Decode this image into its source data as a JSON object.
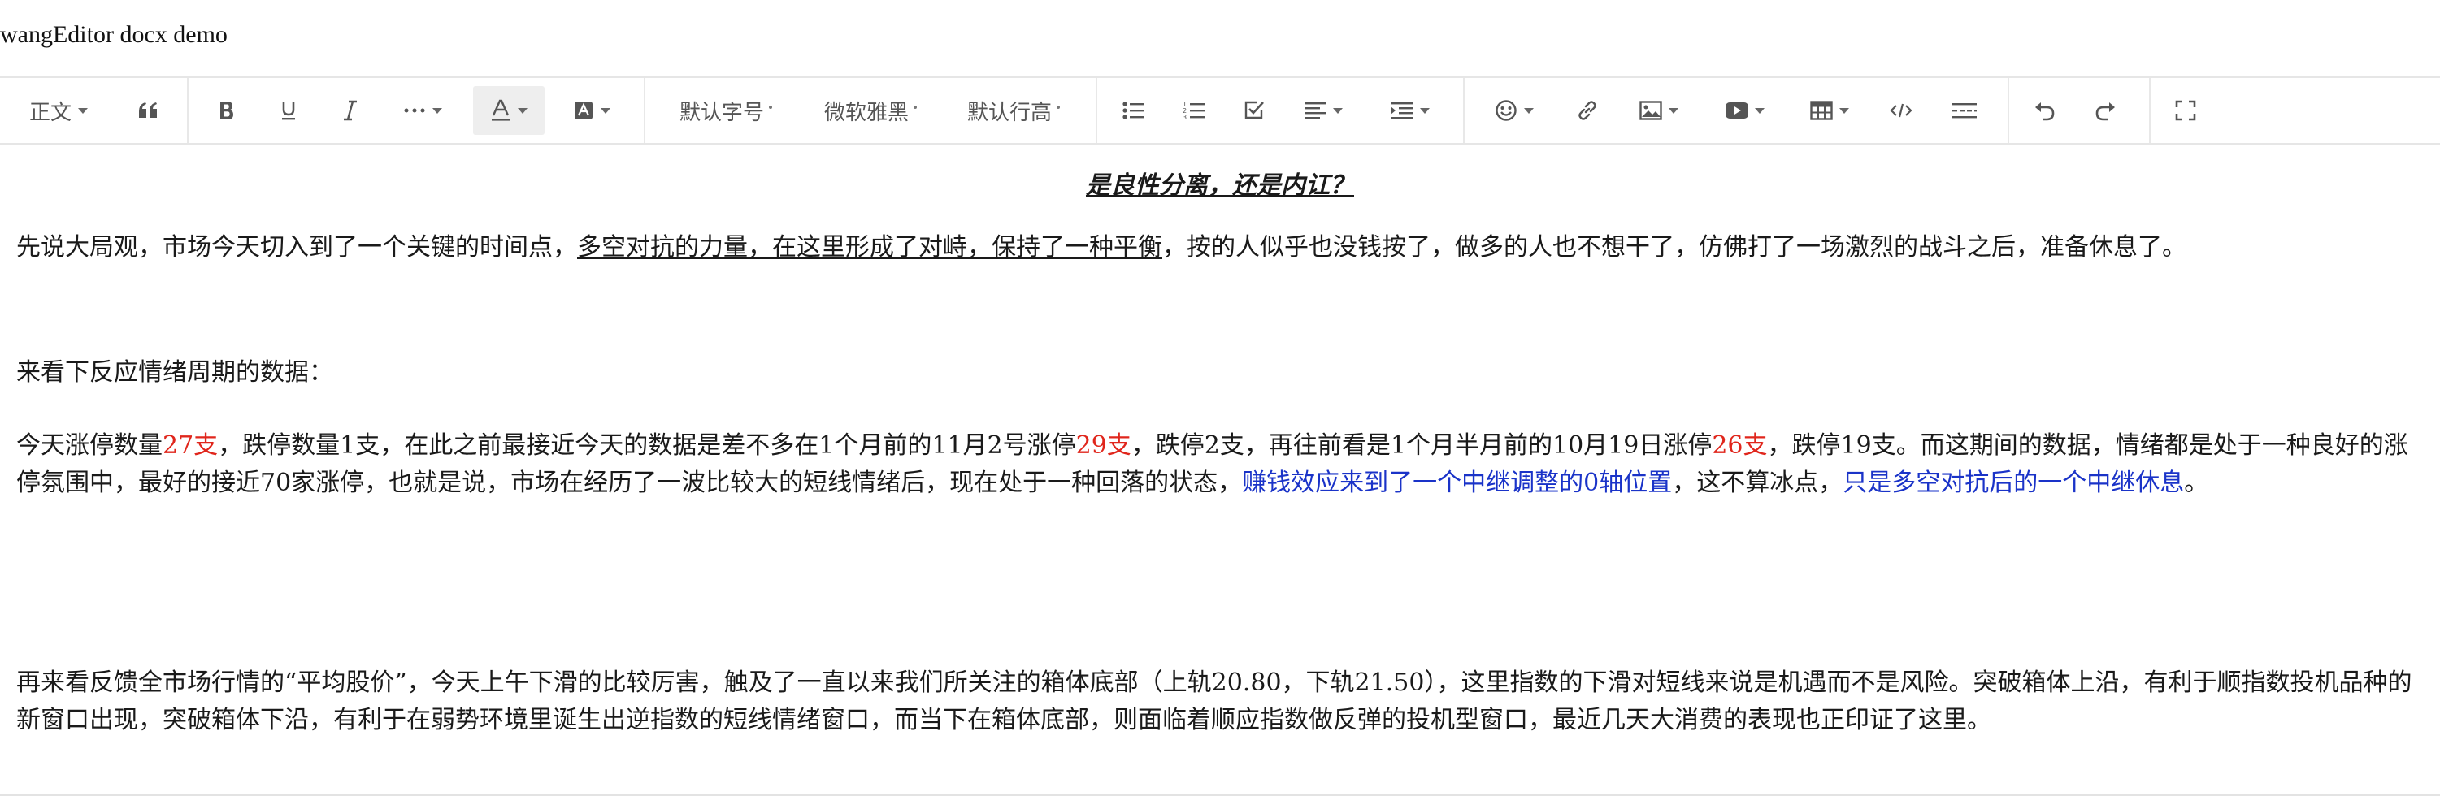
{
  "app": {
    "title": "wangEditor docx demo"
  },
  "toolbar": {
    "paragraph_label": "正文",
    "font_size_label": "默认字号",
    "font_family_label": "微软雅黑",
    "line_height_label": "默认行高",
    "icons": [
      "quote-icon",
      "bold-icon",
      "underline-icon",
      "italic-icon",
      "more-icon",
      "font-color-icon",
      "background-color-icon",
      "bulleted-list-icon",
      "numbered-list-icon",
      "todo-icon",
      "justify-icon",
      "indent-icon",
      "emotion-icon",
      "link-icon",
      "image-icon",
      "video-icon",
      "table-icon",
      "code-icon",
      "divider-icon",
      "undo-icon",
      "redo-icon",
      "fullscreen-icon"
    ]
  },
  "document": {
    "heading": "是良性分离，还是内讧？",
    "p1_a": "先说大局观，市场今天切入到了一个关键的时间点，",
    "p1_u": "多空对抗的力量，在这里形成了对峙，保持了一种平衡",
    "p1_b": "，按的人似乎也没钱按了，做多的人也不想干了，仿佛打了一场激烈的战斗之后，准备休息了。",
    "p2": "来看下反应情绪周期的数据：",
    "p3_a": "今天涨停数量",
    "p3_r1": "27支",
    "p3_b": "，跌停数量1支，在此之前最接近今天的数据是差不多在1个月前的11月2号涨停",
    "p3_r2": "29支",
    "p3_c": "，跌停2支，再往前看是1个月半月前的10月19日涨停",
    "p3_r3": "26支",
    "p3_d": "，跌停19支。而这期间的数据，情绪都是处于一种良好的涨停氛围中，最好的接近70家涨停，也就是说，市场在经历了一波比较大的短线情绪后，现在处于一种回落的状态，",
    "p3_b1": "赚钱效应来到了一个中继调整的0轴位置",
    "p3_e": "，这不算冰点，",
    "p3_b2": "只是多空对抗后的一个中继休息",
    "p3_f": "。",
    "p4": "再来看反馈全市场行情的“平均股价”，今天上午下滑的比较厉害，触及了一直以来我们所关注的箱体底部（上轨20.80，下轨21.50），这里指数的下滑对短线来说是机遇而不是风险。突破箱体上沿，有利于顺指数投机品种的新窗口出现，突破箱体下沿，有利于在弱势环境里诞生出逆指数的短线情绪窗口，而当下在箱体底部，则面临着顺应指数做反弹的投机型窗口，最近几天大消费的表现也正印证了这里。"
  },
  "colors": {
    "red_text": "#e0261c",
    "blue_text": "#1a33c8",
    "toolbar_border": "#e6e6e6"
  }
}
